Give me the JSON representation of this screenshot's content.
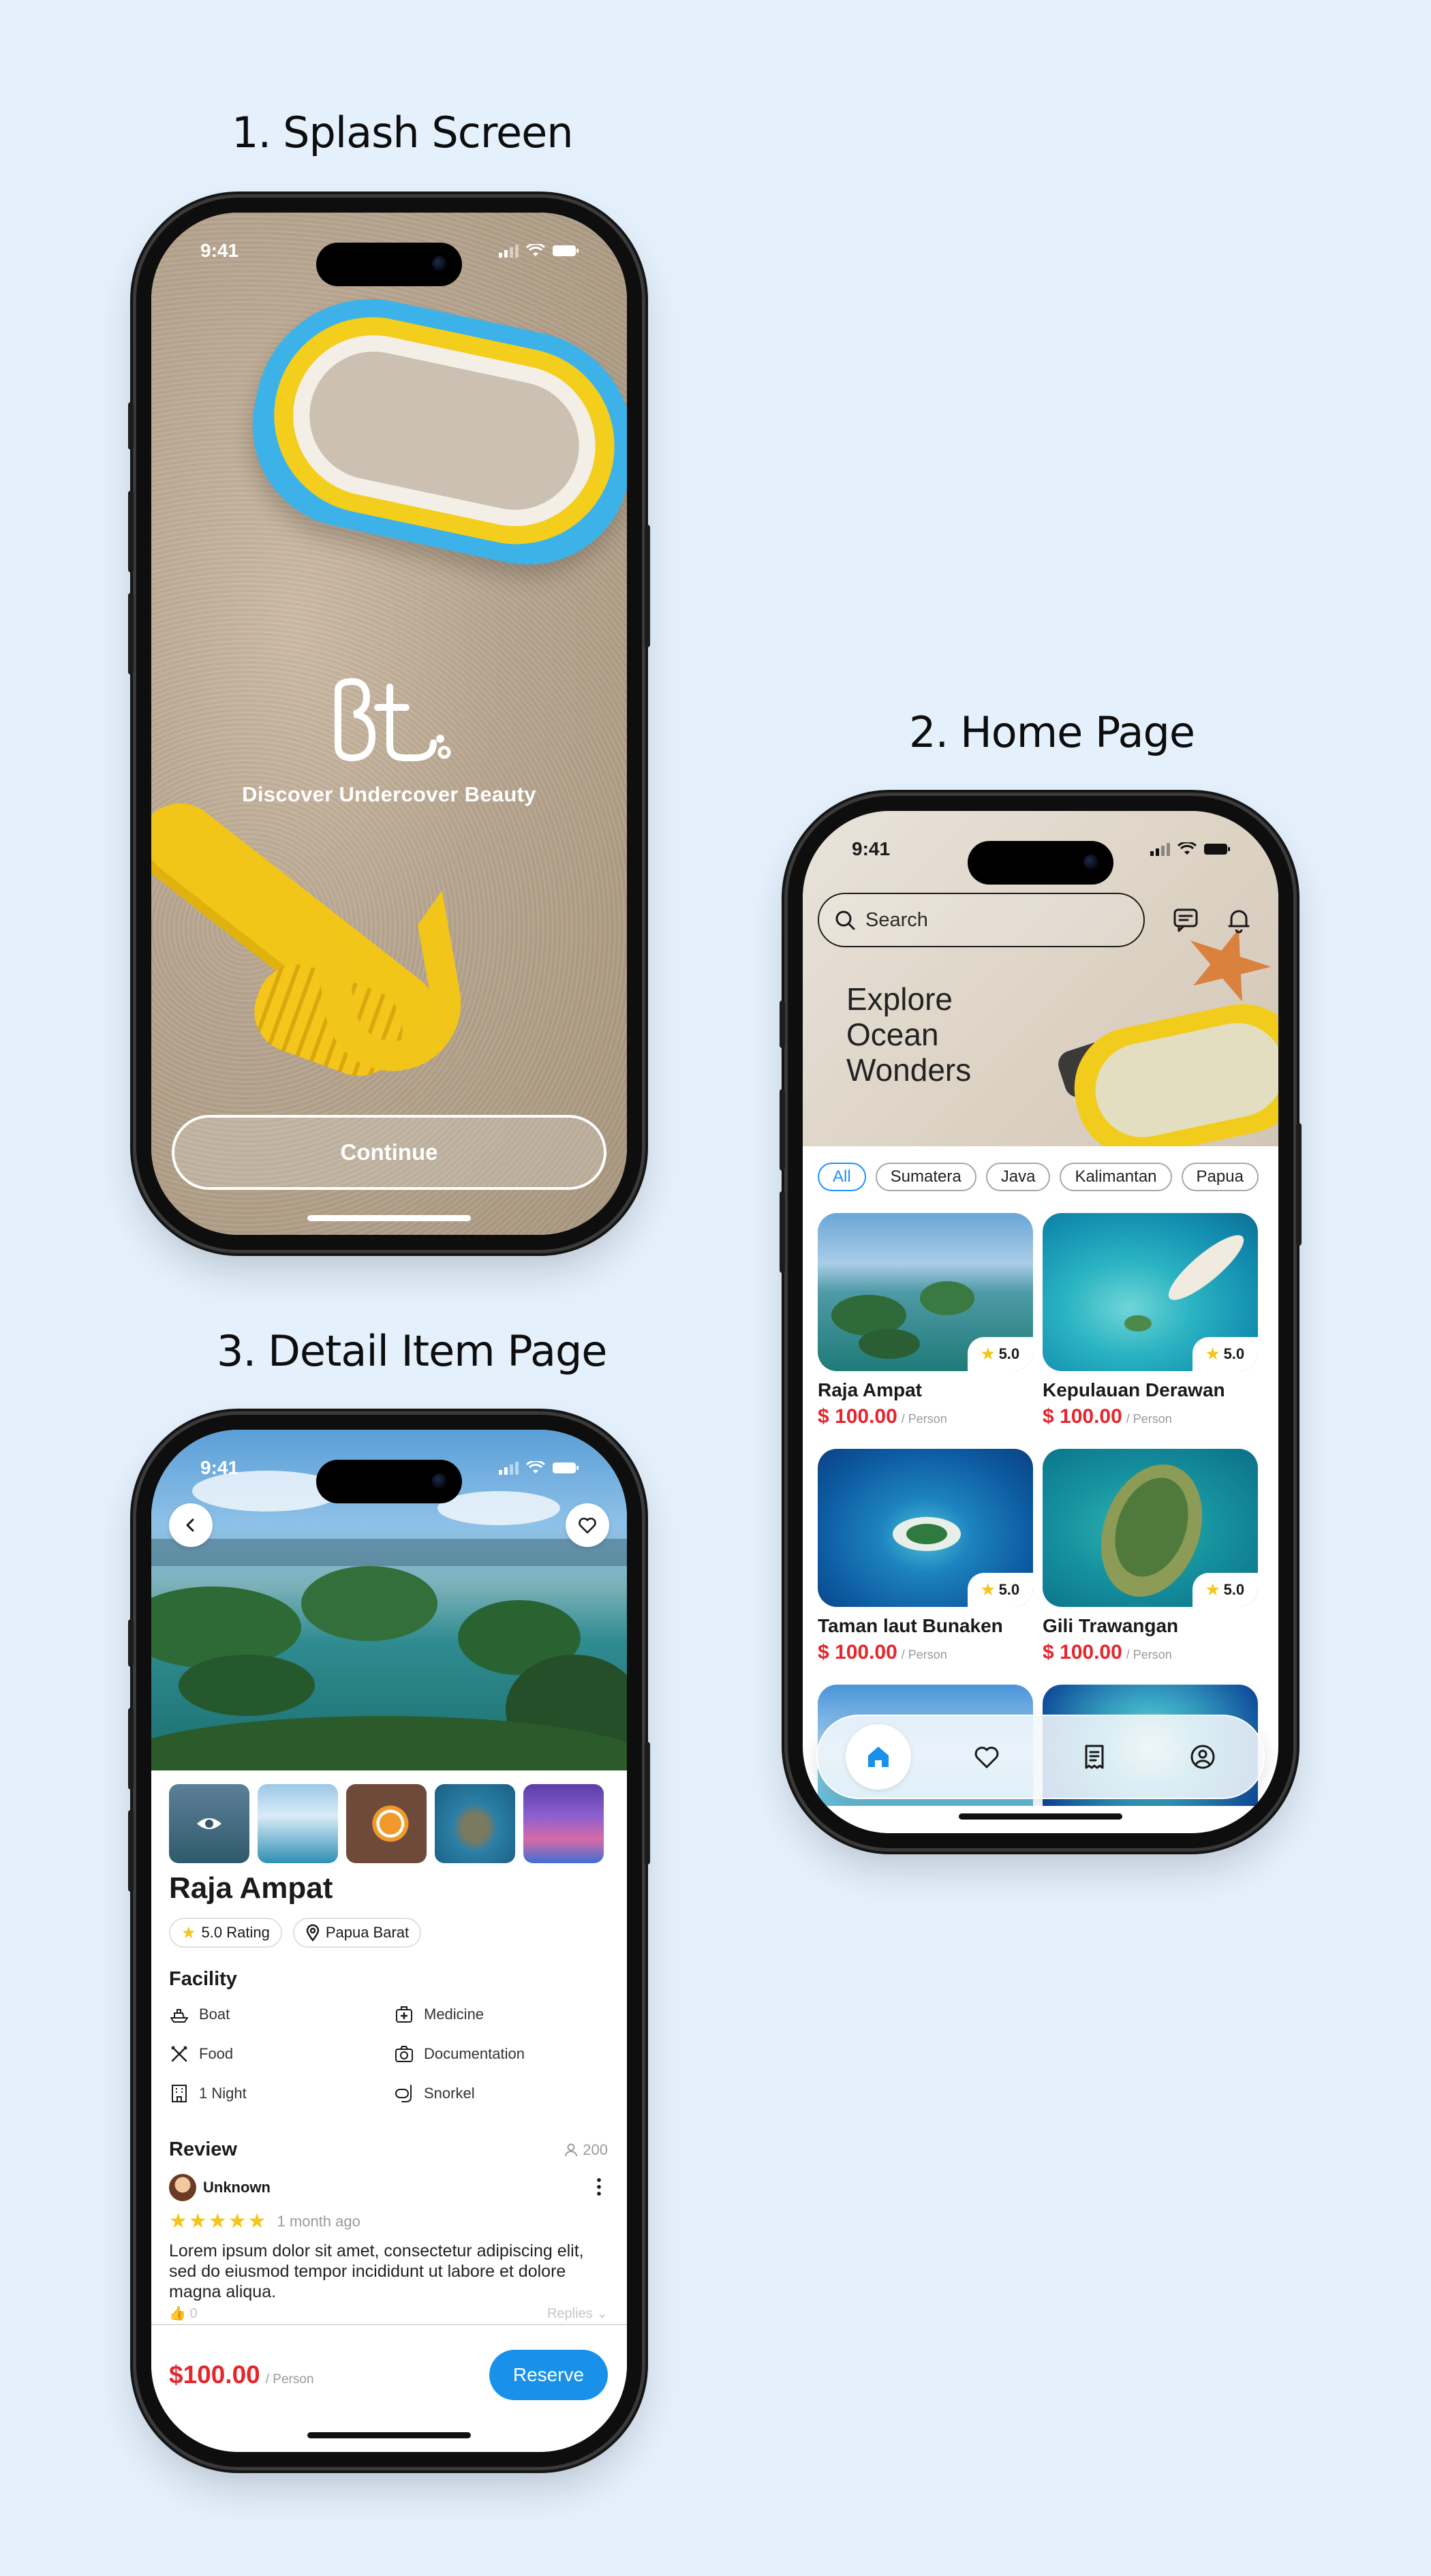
{
  "sections": {
    "splash": {
      "num": "1.",
      "title": "Splash Screen"
    },
    "home": {
      "num": "2.",
      "title": "Home Page"
    },
    "detail": {
      "num": "3.",
      "title": "Detail Item Page"
    }
  },
  "status_time": "9:41",
  "splash": {
    "tagline": "Discover Undercover Beauty",
    "continue_label": "Continue"
  },
  "home": {
    "search_placeholder": "Search",
    "hero_lines": [
      "Explore",
      "Ocean",
      "Wonders"
    ],
    "chips": [
      "All",
      "Sumatera",
      "Java",
      "Kalimantan",
      "Papua"
    ],
    "active_chip": "All",
    "cards": [
      {
        "name": "Raja Ampat",
        "rating": "5.0",
        "price": "$ 100.00",
        "unit": "/ Person"
      },
      {
        "name": "Kepulauan Derawan",
        "rating": "5.0",
        "price": "$ 100.00",
        "unit": "/ Person"
      },
      {
        "name": "Taman laut Bunaken",
        "rating": "5.0",
        "price": "$ 100.00",
        "unit": "/ Person"
      },
      {
        "name": "Gili Trawangan",
        "rating": "5.0",
        "price": "$ 100.00",
        "unit": "/ Person"
      }
    ],
    "nav_icons": [
      "home-icon",
      "heart-icon",
      "receipt-icon",
      "profile-icon"
    ],
    "active_nav": "home-icon"
  },
  "detail": {
    "title": "Raja Ampat",
    "rating_label": "5.0 Rating",
    "location": "Papua Barat",
    "facility_heading": "Facility",
    "facilities": [
      {
        "label": "Boat",
        "icon": "boat-icon"
      },
      {
        "label": "Medicine",
        "icon": "medicine-icon"
      },
      {
        "label": "Food",
        "icon": "food-icon"
      },
      {
        "label": "Documentation",
        "icon": "camera-icon"
      },
      {
        "label": "1 Night",
        "icon": "hotel-icon"
      },
      {
        "label": "Snorkel",
        "icon": "snorkel-icon"
      }
    ],
    "review_heading": "Review",
    "review_count": "200",
    "reviewer_name": "Unknown",
    "review_stars": 5,
    "review_time": "1 month ago",
    "review_text": "Lorem ipsum dolor sit amet, consectetur adipiscing elit, sed do eiusmod tempor incididunt ut labore et dolore magna aliqua.",
    "likes": "0",
    "replies_label": "Replies",
    "price": "$100.00",
    "unit": "/ Person",
    "reserve_label": "Reserve"
  },
  "colors": {
    "accent": "#1991ea",
    "price": "#e6252c",
    "star": "#f5c518",
    "background": "#e4f1fd"
  }
}
